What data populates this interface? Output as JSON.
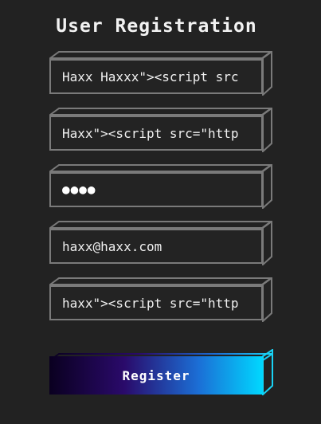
{
  "form": {
    "title": "User Registration",
    "fields": [
      {
        "name": "full-name",
        "value": "Haxx Haxxx\"><script src"
      },
      {
        "name": "username",
        "value": "Haxx\"><script src=\"http"
      },
      {
        "name": "password",
        "value": "●●●●",
        "masked": true
      },
      {
        "name": "email",
        "value": "haxx@haxx.com"
      },
      {
        "name": "extra",
        "value": "haxx\"><script src=\"http"
      }
    ],
    "register_label": "Register"
  },
  "colors": {
    "background": "#222222",
    "field_border": "#7a7a7a",
    "button_gradient_start": "#0a0020",
    "button_gradient_end": "#00d8ff",
    "button_edge": "#19d3f5"
  }
}
